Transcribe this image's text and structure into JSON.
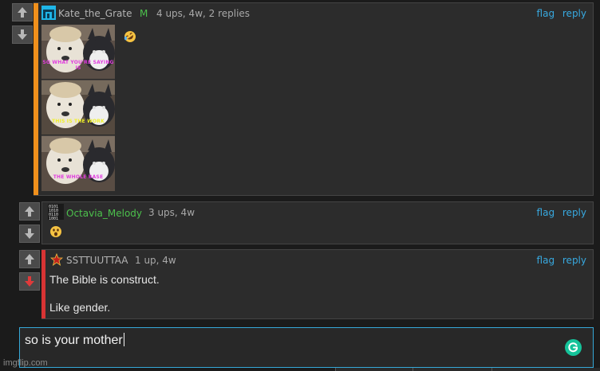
{
  "colors": {
    "accent_op": "#f0901c",
    "accent_downvoted": "#d83434",
    "link": "#38a9e0",
    "username_green": "#4cc04c",
    "username_gray": "#b4b4b4",
    "focus_border": "#35a8d8",
    "grammarly": "#15c39a"
  },
  "comments": [
    {
      "username": "Kate_the_Grate",
      "badge": "M",
      "meta": "4 ups, 4w, 2 replies",
      "flag": "flag",
      "reply": "reply",
      "avatar_icon": "cyan-pixel-avatar-icon",
      "body_emoji_icon": "rolling-on-floor-laughing-emoji-icon",
      "vote_state": "none",
      "meme": {
        "panels": [
          {
            "caption": "SO WHAT YOU'RE SAYING IS",
            "caption_color": "#e23ce0"
          },
          {
            "caption": "THIS IS THE WORK",
            "caption_color": "#f0f02a"
          },
          {
            "caption": "THE WHOLE BASE",
            "caption_color": "#e23ce0"
          }
        ]
      }
    },
    {
      "username": "Octavia_Melody",
      "meta": "3 ups, 4w",
      "flag": "flag",
      "reply": "reply",
      "avatar_icon": "binary-code-avatar-icon",
      "body_emoji_icon": "astonished-face-emoji-icon",
      "vote_state": "none"
    },
    {
      "username": "SSTTUUTTAA",
      "meta": "1 up, 4w",
      "flag": "flag",
      "reply": "reply",
      "avatar_icon": "red-star-avatar-icon",
      "lines": [
        "The Bible is construct.",
        "Like gender."
      ],
      "vote_state": "downvoted"
    }
  ],
  "reply_box": {
    "value": "so is your mother",
    "assistant_icon": "grammarly-icon"
  },
  "watermark": "imgflip.com"
}
